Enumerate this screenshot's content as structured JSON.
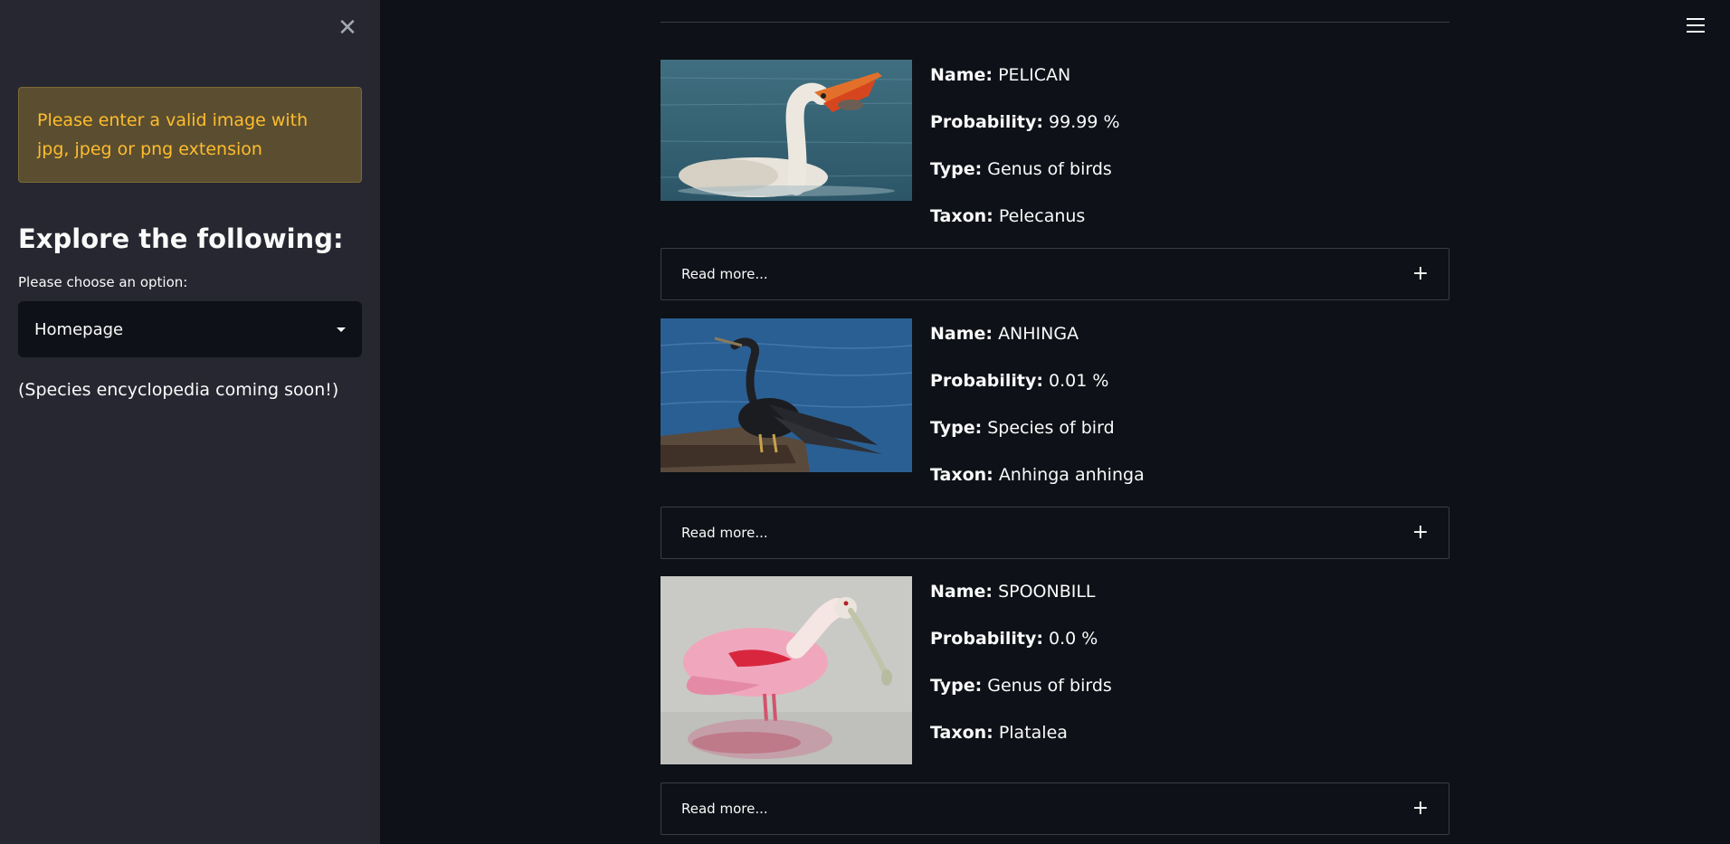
{
  "sidebar": {
    "close_icon": "close-icon",
    "warning_text": "Please enter a valid image with jpg, jpeg or png extension",
    "heading": "Explore the following:",
    "select_label": "Please choose an option:",
    "select_value": "Homepage",
    "coming_soon": "(Species encyclopedia coming soon!)"
  },
  "menu_icon": "hamburger-menu-icon",
  "labels": {
    "name": "Name:",
    "probability": "Probability:",
    "type": "Type:",
    "taxon": "Taxon:"
  },
  "results": [
    {
      "name": "PELICAN",
      "probability": "99.99 %",
      "type": "Genus of birds",
      "taxon": "Pelecanus",
      "read_more": "Read more...",
      "expand_symbol": "+"
    },
    {
      "name": "ANHINGA",
      "probability": "0.01 %",
      "type": "Species of bird",
      "taxon": "Anhinga anhinga",
      "read_more": "Read more...",
      "expand_symbol": "+"
    },
    {
      "name": "SPOONBILL",
      "probability": "0.0 %",
      "type": "Genus of birds",
      "taxon": "Platalea",
      "read_more": "Read more...",
      "expand_symbol": "+"
    }
  ],
  "colors": {
    "sidebar_bg": "#262730",
    "main_bg": "#0e1117",
    "warning_bg": "#5b4e30",
    "warning_text": "#ffbd2e"
  }
}
